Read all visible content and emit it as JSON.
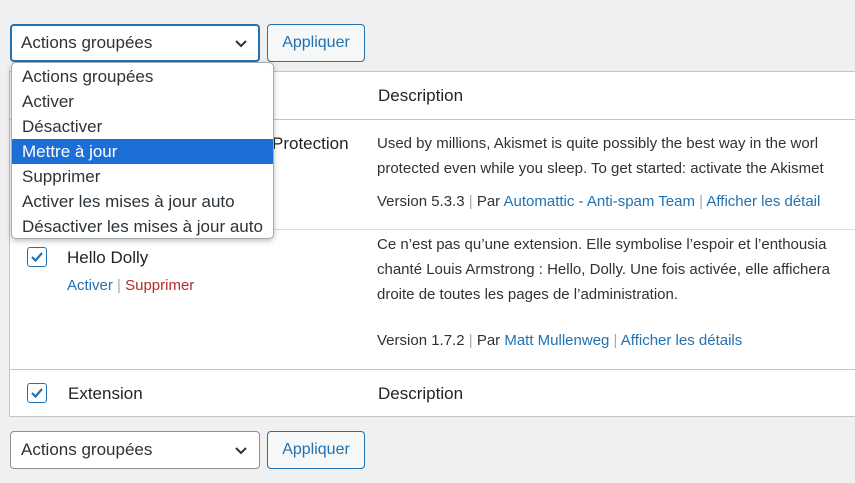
{
  "bulk_top": {
    "selected": "Actions groupées",
    "apply": "Appliquer"
  },
  "bulk_bottom": {
    "selected": "Actions groupées",
    "apply": "Appliquer"
  },
  "dropdown_options": [
    "Actions groupées",
    "Activer",
    "Désactiver",
    "Mettre à jour",
    "Supprimer",
    "Activer les mises à jour auto",
    "Désactiver les mises à jour auto"
  ],
  "dropdown_highlighted": "Mettre à jour",
  "table": {
    "col_description": "Description",
    "col_extension": "Extension",
    "plugins": [
      {
        "name_fragment": "Protection",
        "desc_line1": "Used by millions, Akismet is quite possibly the best way in the worl",
        "desc_line2": "protected even while you sleep. To get started: activate the Akismet",
        "version": "Version 5.3.3",
        "by": "Par",
        "author": "Automattic - Anti-spam Team",
        "details": "Afficher les détail"
      },
      {
        "name": "Hello Dolly",
        "action_activate": "Activer",
        "action_delete": "Supprimer",
        "desc_line1": "Ce n’est pas qu’une extension. Elle symbolise l’espoir et l’enthousia",
        "desc_line2": "chanté Louis Armstrong : Hello, Dolly. Une fois activée, elle affichera",
        "desc_line3": "droite de toutes les pages de l’administration.",
        "version": "Version 1.7.2",
        "by": "Par",
        "author": "Matt Mullenweg",
        "details": "Afficher les détails"
      }
    ]
  },
  "colors": {
    "accent": "#2271b1",
    "delete": "#b32d2e",
    "highlight": "#1e6ed8"
  }
}
